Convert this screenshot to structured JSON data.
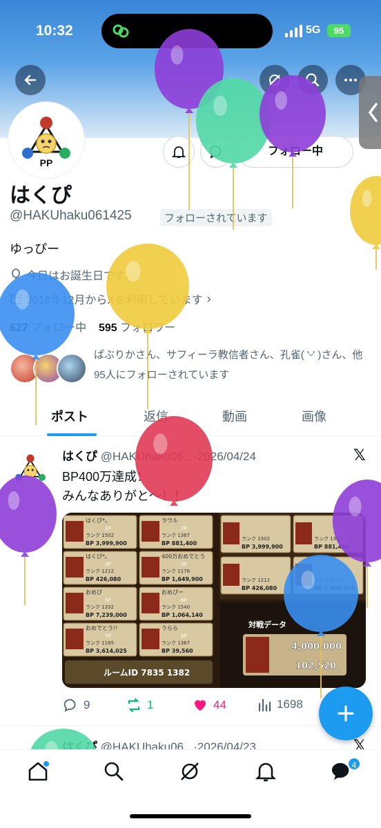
{
  "status_bar": {
    "time": "10:32",
    "network": "5G",
    "battery": "95"
  },
  "profile": {
    "avatar_label": "PP",
    "follow_button": "フォロー中",
    "name": "はくぴ",
    "handle": "@HAKUhaku061425",
    "follows_you": "フォローされています",
    "bio": "ゆっぴー",
    "birthday": "今日はお誕生日です。",
    "joined": "2018年12月からXを利用しています",
    "following_count": "627",
    "following_label": "フォロー中",
    "followers_count": "595",
    "followers_label": "フォロワー",
    "followed_by": "ぱぶりかさん、サフィーラ教信者さん、孔雀( 'ᵕ' )さん、他95人にフォローされています"
  },
  "tabs": [
    {
      "label": "ポスト"
    },
    {
      "label": "返信"
    },
    {
      "label": "動画"
    },
    {
      "label": "画像"
    }
  ],
  "tweet": {
    "author": "はくぴ",
    "meta": "@HAKUhaku06...·2026/04/24",
    "line1": "BP400万達成！",
    "line2": "みんなありがと〜！！",
    "replies": "9",
    "retweets": "1",
    "likes": "44",
    "views": "1698",
    "media": {
      "cards": [
        {
          "name": "はくぴ*。",
          "rank": "1502",
          "bp": "3,999,900",
          "tag": "1P"
        },
        {
          "name": "ラウル",
          "rank": "1367",
          "bp": "881,400",
          "tag": "2P"
        },
        {
          "name": "はくぴ*。",
          "rank": "1212",
          "bp": "426,080",
          "tag": "3P"
        },
        {
          "name": "400万おめでとう",
          "rank": "1178",
          "bp": "1,649,900",
          "tag": "4P"
        },
        {
          "name": "おめぴ",
          "rank": "1332",
          "bp": "7,239,000",
          "tag": "5P"
        },
        {
          "name": "おめぴー",
          "rank": "1540",
          "bp": "1,064,140",
          "tag": "6P"
        },
        {
          "name": "おめでとう!!",
          "rank": "1165",
          "bp": "3,614,025",
          "tag": "7P"
        },
        {
          "name": "うらら",
          "rank": "1367",
          "bp": "39,560",
          "tag": "8P"
        }
      ],
      "room_label": "ルームID",
      "room_id": "7835 1382",
      "battle_title": "対戦データ",
      "battle_bp": "4,000,000",
      "battle_ep": "102,520"
    }
  },
  "tweet2": {
    "author": "はくぴ",
    "meta": "@HAKUhaku06...·2026/04/23"
  },
  "nav": {
    "messages_badge": "4"
  },
  "colors": {
    "accent": "#1d9bf0",
    "like": "#f91880",
    "retweet": "#00ba7c"
  }
}
